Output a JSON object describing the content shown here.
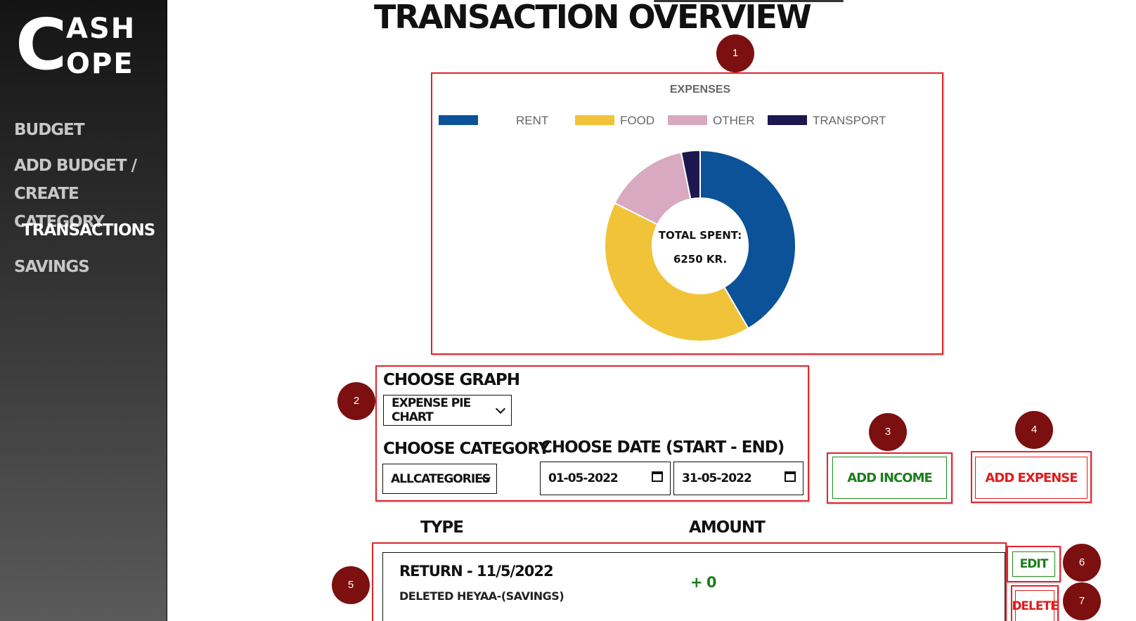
{
  "app": {
    "logo_c": "C",
    "logo_line1": "ASH",
    "logo_line2": "OPE"
  },
  "sidebar": {
    "items": [
      {
        "label": "BUDGET"
      },
      {
        "label": "ADD BUDGET /"
      },
      {
        "label": "CREATE CATEGORY"
      },
      {
        "label": "TRANSACTIONS"
      },
      {
        "label": "SAVINGS"
      }
    ]
  },
  "page": {
    "title": "TRANSACTION OVERVIEW"
  },
  "badges": [
    "1",
    "2",
    "3",
    "4",
    "5",
    "6",
    "7"
  ],
  "chart_data": {
    "type": "pie",
    "title": "EXPENSES",
    "center_line1": "TOTAL SPENT:",
    "center_line2": "6250 KR.",
    "legend": [
      "",
      "RENT",
      "FOOD",
      "OTHER",
      "TRANSPORT"
    ],
    "slices": [
      {
        "name": "",
        "value": 2600,
        "color": "#0b5299"
      },
      {
        "name": "FOOD",
        "value": 2550,
        "color": "#f1c338"
      },
      {
        "name": "OTHER",
        "value": 900,
        "color": "#d8a9c0"
      },
      {
        "name": "TRANSPORT",
        "value": 200,
        "color": "#1d1750"
      }
    ],
    "legend_colors": [
      "#0b5299",
      null,
      "#f1c338",
      "#d8a9c0",
      "#1d1750"
    ]
  },
  "controls": {
    "choose_graph_label": "CHOOSE GRAPH",
    "graph_value": "EXPENSE PIE CHART",
    "choose_category_label": "CHOOSE CATEGORY",
    "category_value": "ALLCATEGORIES",
    "choose_date_label": "CHOOSE DATE (START - END)",
    "start_date": "01-05-2022",
    "end_date": "31-05-2022",
    "add_income": "ADD INCOME",
    "add_expense": "ADD EXPENSE"
  },
  "table": {
    "headers": {
      "type": "TYPE",
      "amount": "AMOUNT"
    },
    "rows": [
      {
        "type": "RETURN - 11/5/2022",
        "note": "DELETED HEYAA-(SAVINGS)",
        "amount": "+ 0",
        "edit": "EDIT",
        "delete": "DELETE"
      }
    ]
  }
}
